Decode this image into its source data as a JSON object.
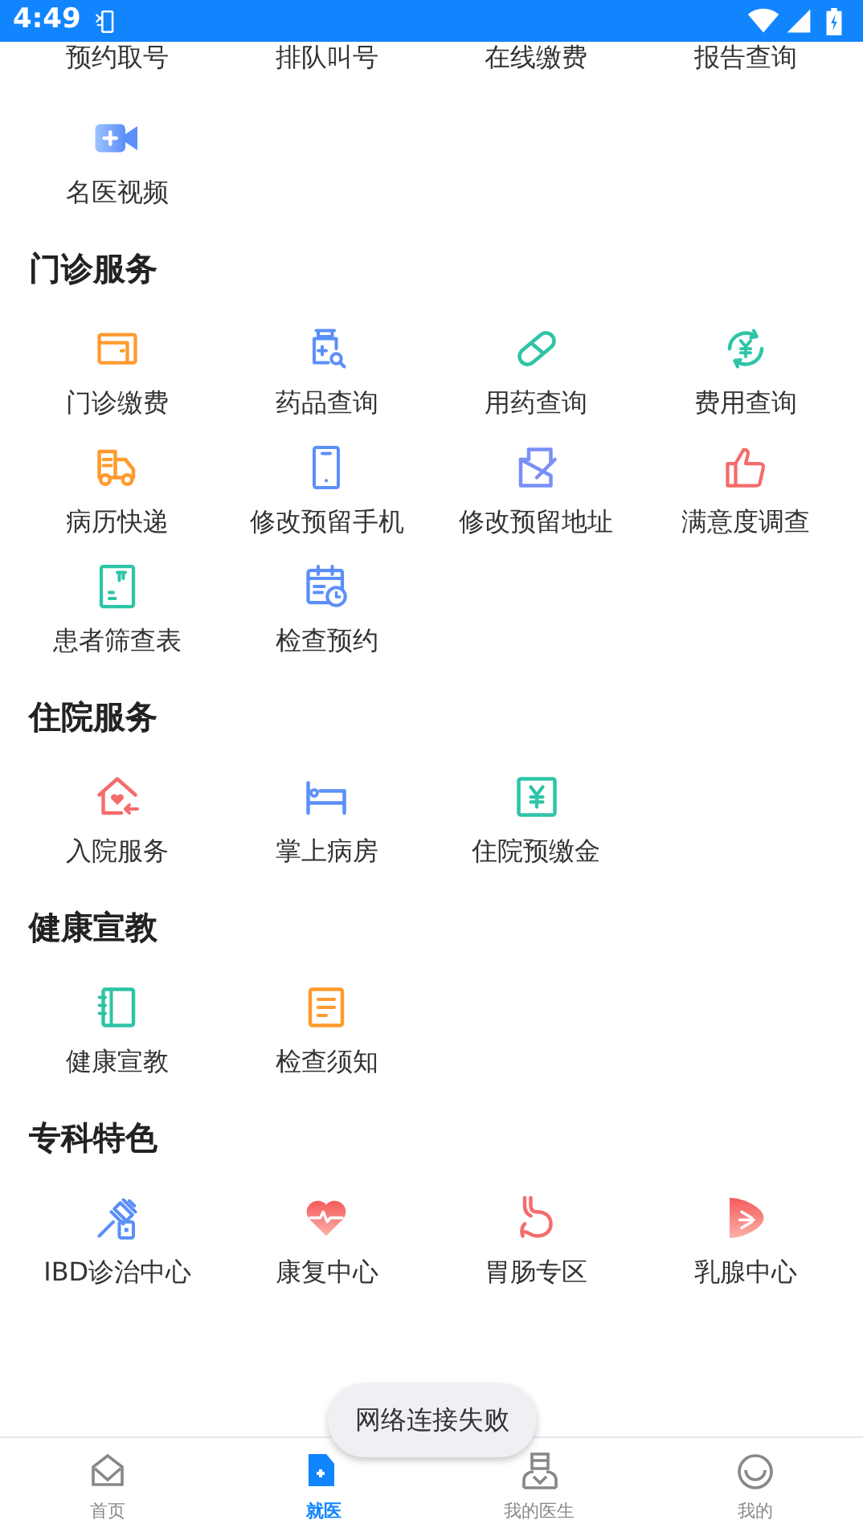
{
  "status_bar": {
    "time": "4:49"
  },
  "sections": [
    {
      "items": [
        {
          "label": "预约取号",
          "kind": "cut"
        },
        {
          "label": "排队叫号",
          "kind": "cut"
        },
        {
          "label": "在线缴费",
          "kind": "cut"
        },
        {
          "label": "报告查询",
          "kind": "cut"
        },
        {
          "label": "名医视频",
          "kind": "full"
        }
      ]
    },
    {
      "title": "门诊服务",
      "items": [
        {
          "label": "门诊缴费",
          "kind": "full"
        },
        {
          "label": "药品查询",
          "kind": "full"
        },
        {
          "label": "用药查询",
          "kind": "full"
        },
        {
          "label": "费用查询",
          "kind": "full"
        },
        {
          "label": "病历快递",
          "kind": "full"
        },
        {
          "label": "修改预留手机",
          "kind": "full"
        },
        {
          "label": "修改预留地址",
          "kind": "full"
        },
        {
          "label": "满意度调查",
          "kind": "full"
        },
        {
          "label": "患者筛查表",
          "kind": "full"
        },
        {
          "label": "检查预约",
          "kind": "full"
        }
      ]
    },
    {
      "title": "住院服务",
      "items": [
        {
          "label": "入院服务",
          "kind": "full"
        },
        {
          "label": "掌上病房",
          "kind": "full"
        },
        {
          "label": "住院预缴金",
          "kind": "full"
        }
      ]
    },
    {
      "title": "健康宣教",
      "items": [
        {
          "label": "健康宣教",
          "kind": "full"
        },
        {
          "label": "检查须知",
          "kind": "full"
        }
      ]
    },
    {
      "title": "专科特色",
      "items": [
        {
          "label": "IBD诊治中心",
          "kind": "full"
        },
        {
          "label": "康复中心",
          "kind": "full"
        },
        {
          "label": "胃肠专区",
          "kind": "full"
        },
        {
          "label": "乳腺中心",
          "kind": "full"
        }
      ]
    }
  ],
  "toast": "网络连接失败",
  "tabs": [
    {
      "label": "首页",
      "selected": false
    },
    {
      "label": "就医",
      "selected": true
    },
    {
      "label": "我的医生",
      "selected": false
    },
    {
      "label": "我的",
      "selected": false
    }
  ]
}
